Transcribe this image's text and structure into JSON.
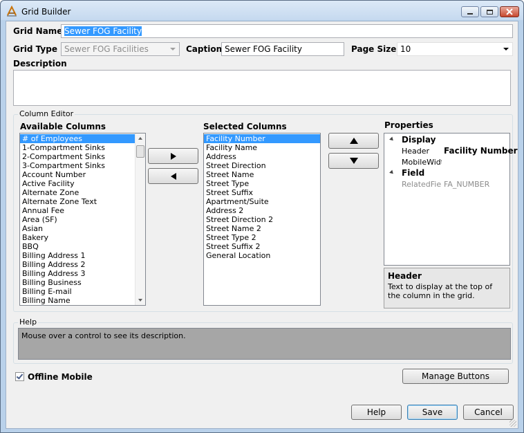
{
  "window": {
    "title": "Grid Builder",
    "min_icon": "minimize-icon",
    "max_icon": "maximize-icon",
    "close_icon": "close-icon"
  },
  "form": {
    "grid_name_label": "Grid Name",
    "grid_name_value": "Sewer FOG Facility",
    "grid_type_label": "Grid Type",
    "grid_type_value": "Sewer FOG Facilities",
    "caption_label": "Caption",
    "caption_value": "Sewer FOG Facility",
    "page_size_label": "Page Size",
    "page_size_value": "10",
    "description_label": "Description",
    "description_value": ""
  },
  "column_editor": {
    "title": "Column Editor",
    "available_label": "Available Columns",
    "available": [
      "# of Employees",
      "1-Compartment Sinks",
      "2-Compartment Sinks",
      "3-Compartment Sinks",
      "Account Number",
      "Active Facility",
      "Alternate Zone",
      "Alternate Zone Text",
      "Annual Fee",
      "Area (SF)",
      "Asian",
      "Bakery",
      "BBQ",
      "Billing  Address 1",
      "Billing  Address 2",
      "Billing  Address 3",
      "Billing  Business",
      "Billing  E-mail",
      "Billing  Name"
    ],
    "available_selected_index": 0,
    "selected_label": "Selected Columns",
    "selected": [
      "Facility Number",
      "Facility Name",
      "Address",
      "Street Direction",
      "Street Name",
      "Street Type",
      "Street Suffix",
      "Apartment/Suite",
      "Address 2",
      "Street Direction 2",
      "Street Name 2",
      "Street Type 2",
      "Street Suffix 2",
      "General Location"
    ],
    "selected_selected_index": 0
  },
  "properties": {
    "title": "Properties",
    "categories": [
      {
        "name": "Display",
        "props": [
          {
            "name": "Header",
            "value": "Facility Number"
          },
          {
            "name": "MobileWidth",
            "value": ""
          }
        ]
      },
      {
        "name": "Field",
        "props": [
          {
            "name": "RelatedField",
            "value": "FA_NUMBER"
          }
        ]
      }
    ],
    "desc_title": "Header",
    "desc_text": "Text to display at the top of the column in the grid."
  },
  "help": {
    "title": "Help",
    "text": "Mouse over a control to see its description."
  },
  "offline_mobile": {
    "label": "Offline Mobile",
    "checked": true
  },
  "buttons": {
    "manage": "Manage Buttons",
    "help": "Help",
    "save": "Save",
    "cancel": "Cancel"
  },
  "colors": {
    "selection": "#3399ff",
    "help_bg": "#a6a6a6",
    "frame": "#b9d1ea"
  }
}
